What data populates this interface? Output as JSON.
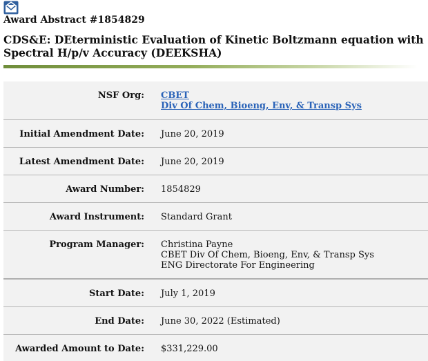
{
  "header": {
    "award_id": "Award Abstract #1854829",
    "title": "CDS&E: DEterministic Evaluation of Kinetic Boltzmann equation with Spectral H/p/v Accuracy (DEEKSHA)"
  },
  "fields": {
    "nsf_org": {
      "label": "NSF Org:",
      "link1": "CBET",
      "link2": "Div Of Chem, Bioeng, Env, & Transp Sys"
    },
    "initial_amendment": {
      "label": "Initial Amendment Date:",
      "value": "June 20, 2019"
    },
    "latest_amendment": {
      "label": "Latest Amendment Date:",
      "value": "June 20, 2019"
    },
    "award_number": {
      "label": "Award Number:",
      "value": "1854829"
    },
    "award_instrument": {
      "label": "Award Instrument:",
      "value": "Standard Grant"
    },
    "program_manager": {
      "label": "Program Manager:",
      "name": "Christina Payne",
      "division": "CBET Div Of Chem, Bioeng, Env, & Transp Sys",
      "directorate": "ENG Directorate For Engineering"
    },
    "start_date": {
      "label": "Start Date:",
      "value": "July 1, 2019"
    },
    "end_date": {
      "label": "End Date:",
      "value": "June 30, 2022 (Estimated)"
    },
    "awarded_amount": {
      "label": "Awarded Amount to Date:",
      "value": "$331,229.00"
    }
  },
  "colors": {
    "link": "#2a63b8",
    "panel": "#f2f2f2",
    "accent_green": "#6f8d3a"
  },
  "icons": {
    "mail": "envelope-icon"
  }
}
